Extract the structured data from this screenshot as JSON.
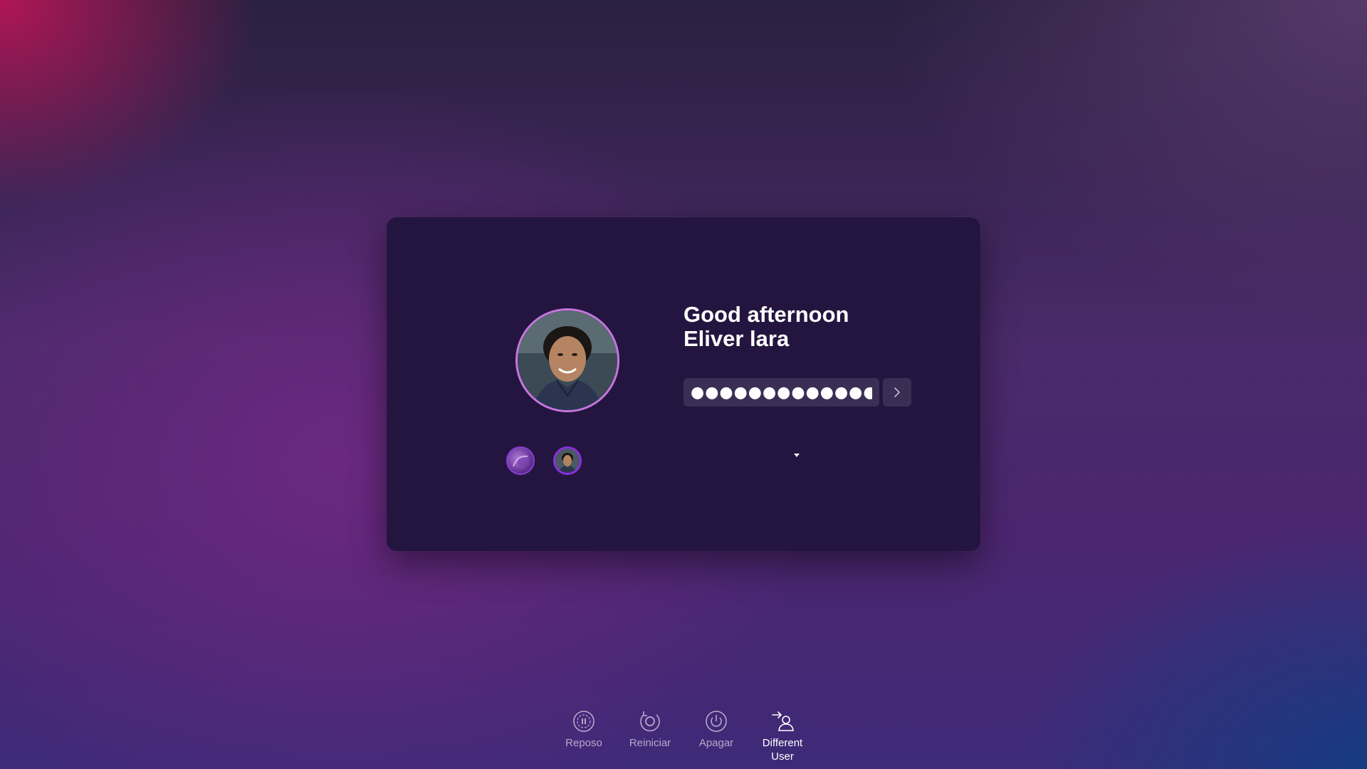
{
  "login": {
    "greeting_line1": "Good afternoon",
    "greeting_line2": "Eliver lara",
    "password_value": "●●●●●●●●●●●●●",
    "accent_color": "#c876e0"
  },
  "users": [
    {
      "name": "user-1",
      "avatar": "abstract-purple"
    },
    {
      "name": "user-2",
      "avatar": "photo",
      "selected": true
    }
  ],
  "power": {
    "sleep_label": "Reposo",
    "restart_label": "Reiniciar",
    "shutdown_label": "Apagar",
    "different_user_label": "Different User"
  }
}
